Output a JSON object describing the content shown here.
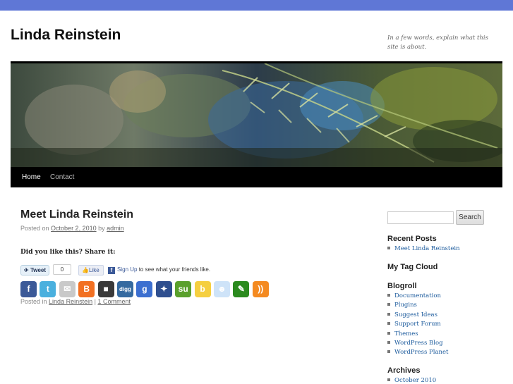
{
  "site": {
    "title": "Linda Reinstein",
    "description": "In a few words, explain what this site is about."
  },
  "nav": [
    {
      "label": "Home"
    },
    {
      "label": "Contact"
    }
  ],
  "post": {
    "title": "Meet Linda Reinstein",
    "posted_on": "Posted on",
    "date": "October 2, 2010",
    "by": "by",
    "author": "admin",
    "share_title": "Did you like this? Share it:",
    "tweet_label": "Tweet",
    "tweet_count": "0",
    "like_label": "Like",
    "fb_signup_link": "Sign Up",
    "fb_signup_text": " to see what your friends like.",
    "posted_in": "Posted in",
    "category": "Linda Reinstein",
    "separator": "|",
    "comments": "1 Comment"
  },
  "share_icons": [
    {
      "name": "facebook-icon",
      "glyph": "f",
      "color": "#3b5998"
    },
    {
      "name": "twitter-icon",
      "glyph": "t",
      "color": "#4ab0de"
    },
    {
      "name": "email-icon",
      "glyph": "✉",
      "color": "#c9c9c9"
    },
    {
      "name": "blogger-icon",
      "glyph": "B",
      "color": "#f27022"
    },
    {
      "name": "delicious-icon",
      "glyph": "■",
      "color": "#3a3a3a"
    },
    {
      "name": "digg-icon",
      "glyph": "digg",
      "color": "#356aa0"
    },
    {
      "name": "google-icon",
      "glyph": "g",
      "color": "#3c6fd0"
    },
    {
      "name": "myspace-icon",
      "glyph": "✦",
      "color": "#2f4f8f"
    },
    {
      "name": "stumbleupon-icon",
      "glyph": "su",
      "color": "#5aa02c"
    },
    {
      "name": "buzz-icon",
      "glyph": "b",
      "color": "#f5cf40"
    },
    {
      "name": "reddit-icon",
      "glyph": "☻",
      "color": "#cee3f8"
    },
    {
      "name": "speech-icon",
      "glyph": "✎",
      "color": "#2b8a1e"
    },
    {
      "name": "rss-icon",
      "glyph": "))",
      "color": "#f48a21"
    }
  ],
  "sidebar": {
    "search_button": "Search",
    "search_placeholder": "",
    "recent_posts_title": "Recent Posts",
    "recent_posts": [
      {
        "label": "Meet Linda Reinstein"
      }
    ],
    "tag_cloud_title": "My Tag Cloud",
    "blogroll_title": "Blogroll",
    "blogroll": [
      {
        "label": "Documentation"
      },
      {
        "label": "Plugins"
      },
      {
        "label": "Suggest Ideas"
      },
      {
        "label": "Support Forum"
      },
      {
        "label": "Themes"
      },
      {
        "label": "WordPress Blog"
      },
      {
        "label": "WordPress Planet"
      }
    ],
    "archives_title": "Archives",
    "archives": [
      {
        "label": "October 2010"
      }
    ]
  },
  "colors": {
    "top_bar": "#5f77d6",
    "nav_bar": "#000000",
    "link": "#1b5a9c"
  }
}
